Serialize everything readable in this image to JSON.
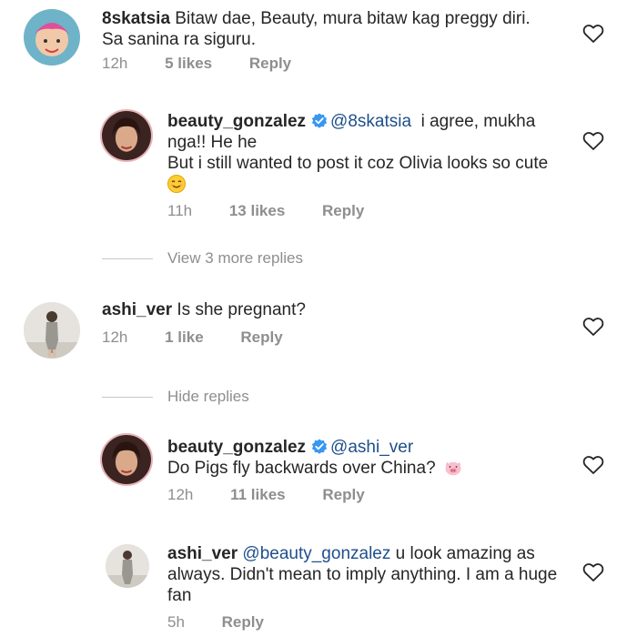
{
  "comments": [
    {
      "username": "8skatsia",
      "text": "Bitaw dae, Beauty, mura bitaw kag preggy diri. Sa sanina ra siguru.",
      "time": "12h",
      "likes": "5 likes",
      "reply": "Reply"
    },
    {
      "username": "beauty_gonzalez",
      "mention": "@8skatsia",
      "text_line1": "i agree, mukha",
      "text_line2": "nga!! He he",
      "text_line3": "But i still wanted to post it coz Olivia looks so cute",
      "time": "11h",
      "likes": "13 likes",
      "reply": "Reply"
    },
    {
      "username": "ashi_ver",
      "text": "Is she pregnant?",
      "time": "12h",
      "likes": "1 like",
      "reply": "Reply"
    },
    {
      "username": "beauty_gonzalez",
      "mention": "@ashi_ver",
      "text": "Do Pigs fly backwards over China?",
      "time": "12h",
      "likes": "11 likes",
      "reply": "Reply"
    },
    {
      "username": "ashi_ver",
      "mention": "@beauty_gonzalez",
      "text_line1": "u look amazing as",
      "text_line2": "always. Didn't mean to imply anything. I am a huge",
      "text_line3": "fan",
      "time": "5h",
      "reply": "Reply"
    }
  ],
  "view_more_replies": "View 3 more replies",
  "hide_replies": "Hide replies",
  "colors": {
    "mention": "#1e4f8c",
    "meta": "#8e8e8e",
    "verified": "#3897f0"
  }
}
